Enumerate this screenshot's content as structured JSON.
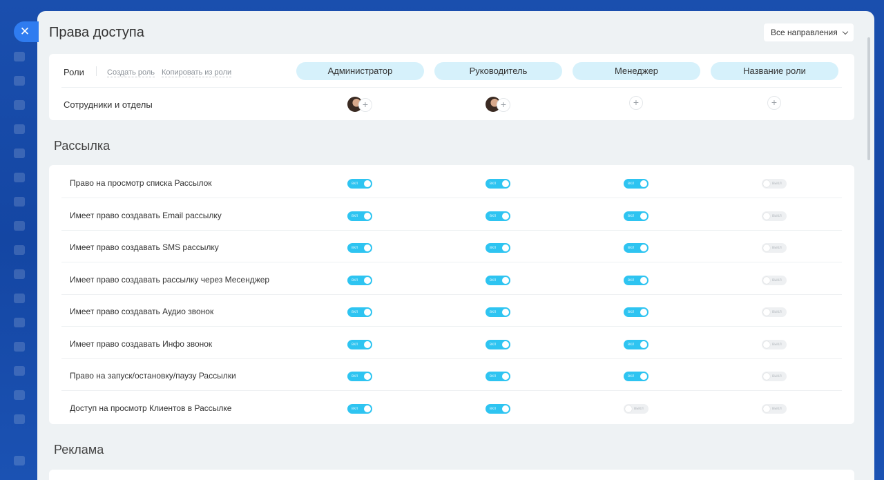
{
  "page_title": "Права доступа",
  "direction_select": "Все направления",
  "roles": {
    "label": "Роли",
    "create_link": "Создать роль",
    "copy_link": "Копировать из роли",
    "columns": [
      "Администратор",
      "Руководитель",
      "Менеджер",
      "Название роли"
    ]
  },
  "staff": {
    "label": "Сотрудники и отделы",
    "add_symbol": "+",
    "has_avatar": [
      true,
      true,
      false,
      false
    ]
  },
  "toggle_text": {
    "on": "вкл",
    "off": "выкл"
  },
  "sections": [
    {
      "title": "Рассылка",
      "permissions": [
        {
          "label": "Право на просмотр списка Рассылок",
          "values": [
            true,
            true,
            true,
            false
          ]
        },
        {
          "label": "Имеет право создавать Email рассылку",
          "values": [
            true,
            true,
            true,
            false
          ]
        },
        {
          "label": "Имеет право создавать SMS рассылку",
          "values": [
            true,
            true,
            true,
            false
          ]
        },
        {
          "label": "Имеет право создавать рассылку через Месенджер",
          "values": [
            true,
            true,
            true,
            false
          ]
        },
        {
          "label": "Имеет право создавать Аудио звонок",
          "values": [
            true,
            true,
            true,
            false
          ]
        },
        {
          "label": "Имеет право создавать Инфо звонок",
          "values": [
            true,
            true,
            true,
            false
          ]
        },
        {
          "label": "Право на запуск/остановку/паузу Рассылки",
          "values": [
            true,
            true,
            true,
            false
          ]
        },
        {
          "label": "Доступ на просмотр Клиентов в Рассылке",
          "values": [
            true,
            true,
            false,
            false
          ]
        }
      ]
    },
    {
      "title": "Реклама",
      "permissions": []
    }
  ],
  "colors": {
    "accent": "#2ec4f1",
    "role_pill": "#d6f1fb",
    "close_button": "#2f7cf0"
  }
}
